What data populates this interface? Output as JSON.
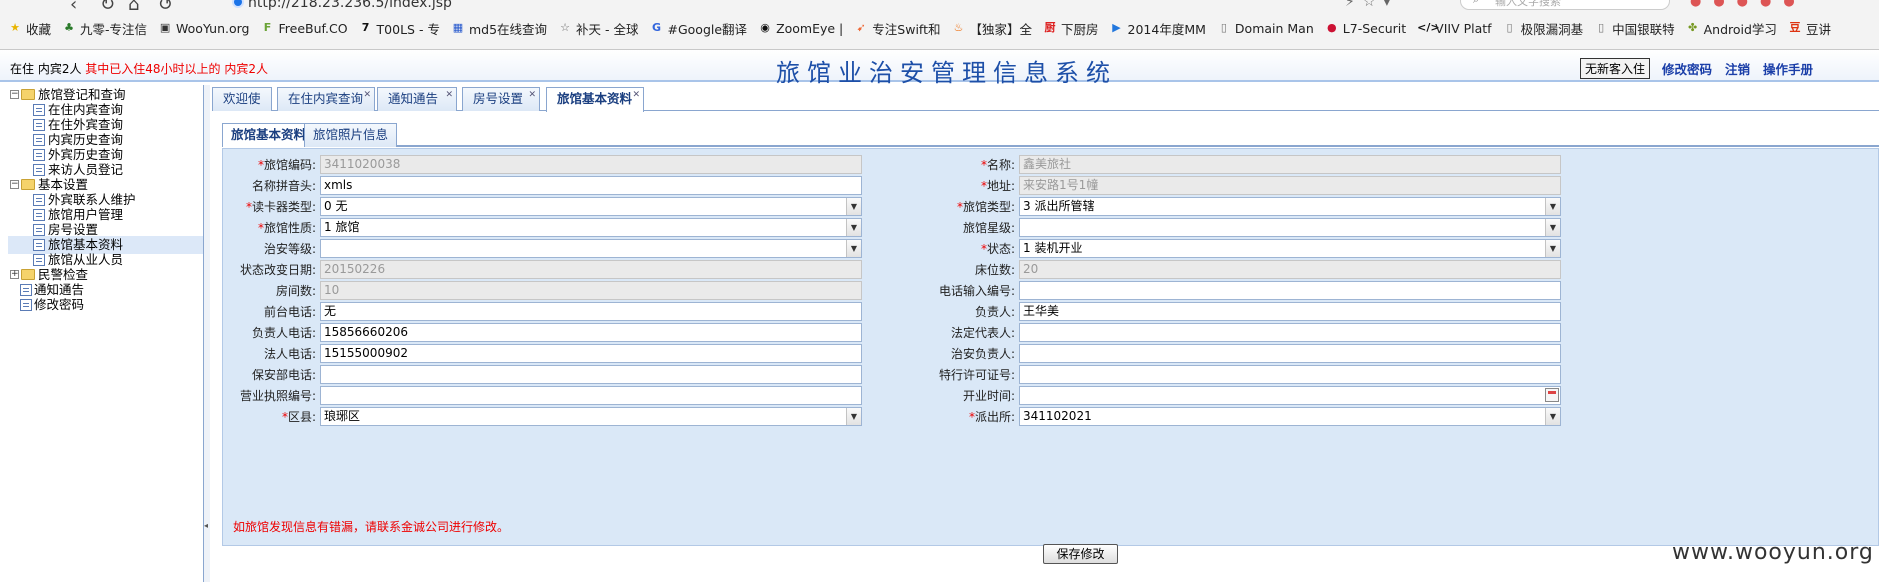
{
  "browser": {
    "url": "http://218.23.236.5/index.jsp",
    "search_placeholder": "输入文字搜索",
    "bookmarks": [
      {
        "label": "收藏",
        "icon": "star-icon",
        "color": "#e8b400"
      },
      {
        "label": "九零-专注信",
        "icon": "tree-icon",
        "color": "#2a7a2a"
      },
      {
        "label": "WooYun.org",
        "icon": "wooyun-icon",
        "color": "#333333"
      },
      {
        "label": "FreeBuf.CO",
        "icon": "freebuf-icon",
        "color": "#6aa336"
      },
      {
        "label": "T00LS - 专",
        "icon": "t00ls-icon",
        "color": "#111111"
      },
      {
        "label": "md5在线查询",
        "icon": "grid-icon",
        "color": "#2255cc"
      },
      {
        "label": "补天 - 全球",
        "icon": "butian-icon",
        "color": "#666666"
      },
      {
        "label": "#Google翻译",
        "icon": "translate-icon",
        "color": "#3366dd"
      },
      {
        "label": "ZoomEye |",
        "icon": "zoomeye-icon",
        "color": "#111111"
      },
      {
        "label": "专注Swift和",
        "icon": "swift-icon",
        "color": "#ee6633"
      },
      {
        "label": "【独家】全",
        "icon": "flame-icon",
        "color": "#ee6600"
      },
      {
        "label": "下厨房",
        "icon": "kitchen-icon",
        "color": "#dd2222"
      },
      {
        "label": "2014年度MM",
        "icon": "play-icon",
        "color": "#2277dd"
      },
      {
        "label": "Domain Man",
        "icon": "page-icon",
        "color": "#777777"
      },
      {
        "label": "L7-Securit",
        "icon": "l7-icon",
        "color": "#cc1133"
      },
      {
        "label": "VIIV Platf",
        "icon": "code-icon",
        "color": "#111111"
      },
      {
        "label": "极限漏洞基",
        "icon": "page-icon",
        "color": "#777777"
      },
      {
        "label": "中国银联特",
        "icon": "page-icon",
        "color": "#777777"
      },
      {
        "label": "Android学习",
        "icon": "android-icon",
        "color": "#779922"
      },
      {
        "label": "豆讲",
        "icon": "douban-icon",
        "color": "#dd3311"
      }
    ]
  },
  "header": {
    "status_prefix": "在住 内宾2人",
    "status_warning": "其中已入住48小时以上的 内宾2人",
    "title": "旅馆业治安管理信息系统",
    "checkin_button": "无新客入住",
    "change_password": "修改密码",
    "logout": "注销",
    "manual": "操作手册"
  },
  "sidebar": {
    "groups": [
      {
        "label": "旅馆登记和查询",
        "expanded": true,
        "items": [
          "在住内宾查询",
          "在住外宾查询",
          "内宾历史查询",
          "外宾历史查询",
          "来访人员登记"
        ]
      },
      {
        "label": "基本设置",
        "expanded": true,
        "items": [
          "外宾联系人维护",
          "旅馆用户管理",
          "房号设置",
          "旅馆基本资料",
          "旅馆从业人员"
        ]
      },
      {
        "label": "民警检查",
        "expanded": false,
        "items": []
      }
    ],
    "top_items": [
      "通知通告",
      "修改密码"
    ],
    "selected": "旅馆基本资料"
  },
  "tabs": [
    "欢迎使用",
    "在住内宾查询",
    "通知通告",
    "房号设置",
    "旅馆基本资料"
  ],
  "subtabs": [
    "旅馆基本资料",
    "旅馆照片信息"
  ],
  "form": {
    "left": [
      {
        "label": "旅馆编码:",
        "required": true,
        "value": "3411020038",
        "readonly": true,
        "select": false
      },
      {
        "label": "名称拼音头:",
        "required": false,
        "value": "xmls",
        "readonly": false,
        "select": false
      },
      {
        "label": "读卡器类型:",
        "required": true,
        "value": "0 无",
        "readonly": false,
        "select": true
      },
      {
        "label": "旅馆性质:",
        "required": true,
        "value": "1 旅馆",
        "readonly": false,
        "select": true
      },
      {
        "label": "治安等级:",
        "required": false,
        "value": "",
        "readonly": false,
        "select": true
      },
      {
        "label": "状态改变日期:",
        "required": false,
        "value": "20150226",
        "readonly": true,
        "select": false
      },
      {
        "label": "房间数:",
        "required": false,
        "value": "10",
        "readonly": true,
        "select": false
      },
      {
        "label": "前台电话:",
        "required": false,
        "value": "无",
        "readonly": false,
        "select": false
      },
      {
        "label": "负责人电话:",
        "required": false,
        "value": "15856660206",
        "readonly": false,
        "select": false
      },
      {
        "label": "法人电话:",
        "required": false,
        "value": "15155000902",
        "readonly": false,
        "select": false
      },
      {
        "label": "保安部电话:",
        "required": false,
        "value": "",
        "readonly": false,
        "select": false
      },
      {
        "label": "营业执照编号:",
        "required": false,
        "value": "",
        "readonly": false,
        "select": false
      },
      {
        "label": "区县:",
        "required": true,
        "value": "琅琊区",
        "readonly": false,
        "select": true
      }
    ],
    "right": [
      {
        "label": "名称:",
        "required": true,
        "value": "鑫美旅社",
        "readonly": true,
        "select": false
      },
      {
        "label": "地址:",
        "required": true,
        "value": "来安路1号1幢",
        "readonly": true,
        "select": false
      },
      {
        "label": "旅馆类型:",
        "required": true,
        "value": "3 派出所管辖",
        "readonly": false,
        "select": true
      },
      {
        "label": "旅馆星级:",
        "required": false,
        "value": "",
        "readonly": false,
        "select": true
      },
      {
        "label": "状态:",
        "required": true,
        "value": "1 装机开业",
        "readonly": false,
        "select": true
      },
      {
        "label": "床位数:",
        "required": false,
        "value": "20",
        "readonly": true,
        "select": false
      },
      {
        "label": "电话输入编号:",
        "required": false,
        "value": "",
        "readonly": false,
        "select": false
      },
      {
        "label": "负责人:",
        "required": false,
        "value": "王华美",
        "readonly": false,
        "select": false
      },
      {
        "label": "法定代表人:",
        "required": false,
        "value": "",
        "readonly": false,
        "select": false
      },
      {
        "label": "治安负责人:",
        "required": false,
        "value": "",
        "readonly": false,
        "select": false
      },
      {
        "label": "特行许可证号:",
        "required": false,
        "value": "",
        "readonly": false,
        "select": false
      },
      {
        "label": "开业时间:",
        "required": false,
        "value": "",
        "readonly": false,
        "select": false,
        "calendar": true
      },
      {
        "label": "派出所:",
        "required": true,
        "value": "341102021",
        "readonly": false,
        "select": true
      }
    ],
    "notice": "如旅馆发现信息有错漏，请联系金诚公司进行修改。",
    "save_button": "保存修改"
  },
  "watermark": "www.wooyun.org"
}
